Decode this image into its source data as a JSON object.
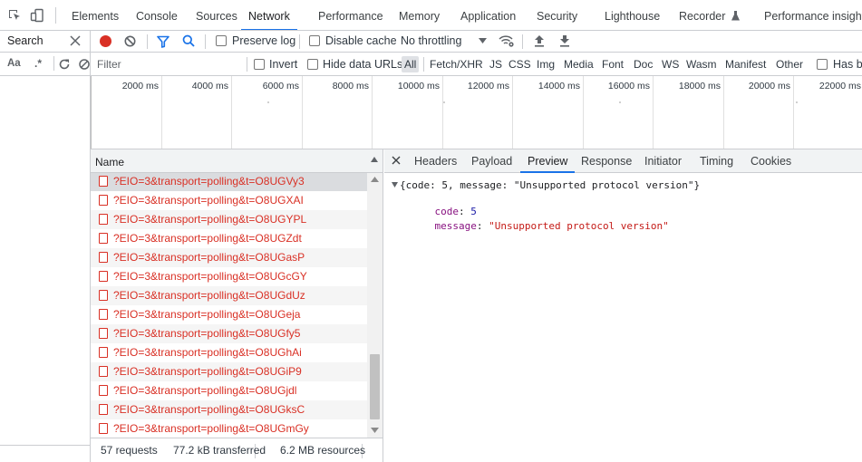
{
  "main_tabs": [
    "Elements",
    "Console",
    "Sources",
    "Network",
    "Performance",
    "Memory",
    "Application",
    "Security",
    "Lighthouse",
    "Recorder",
    "Performance insights"
  ],
  "active_tab": "Network",
  "sidebar": {
    "search_label": "Search",
    "match_case": "Aa",
    "regex": ".*"
  },
  "toolbar": {
    "preserve_log": "Preserve log",
    "disable_cache": "Disable cache",
    "throttling": "No throttling"
  },
  "filterbar": {
    "filter_placeholder": "Filter",
    "invert": "Invert",
    "hide_data_urls": "Hide data URLs",
    "types": [
      "All",
      "Fetch/XHR",
      "JS",
      "CSS",
      "Img",
      "Media",
      "Font",
      "Doc",
      "WS",
      "Wasm",
      "Manifest",
      "Other"
    ],
    "selected_type": "All",
    "has_blocked": "Has bl"
  },
  "overview": {
    "ticks": [
      "2000 ms",
      "4000 ms",
      "6000 ms",
      "8000 ms",
      "10000 ms",
      "12000 ms",
      "14000 ms",
      "16000 ms",
      "18000 ms",
      "20000 ms",
      "22000 ms"
    ]
  },
  "requests": {
    "column_name": "Name",
    "rows": [
      "?EIO=3&transport=polling&t=O8UGVy3",
      "?EIO=3&transport=polling&t=O8UGXAI",
      "?EIO=3&transport=polling&t=O8UGYPL",
      "?EIO=3&transport=polling&t=O8UGZdt",
      "?EIO=3&transport=polling&t=O8UGasP",
      "?EIO=3&transport=polling&t=O8UGcGY",
      "?EIO=3&transport=polling&t=O8UGdUz",
      "?EIO=3&transport=polling&t=O8UGeja",
      "?EIO=3&transport=polling&t=O8UGfy5",
      "?EIO=3&transport=polling&t=O8UGhAi",
      "?EIO=3&transport=polling&t=O8UGiP9",
      "?EIO=3&transport=polling&t=O8UGjdl",
      "?EIO=3&transport=polling&t=O8UGksC",
      "?EIO=3&transport=polling&t=O8UGmGy"
    ],
    "status_requests": "57 requests",
    "status_transferred": "77.2 kB transferred",
    "status_resources": "6.2 MB resources"
  },
  "details": {
    "tabs": [
      "Headers",
      "Payload",
      "Preview",
      "Response",
      "Initiator",
      "Timing",
      "Cookies"
    ],
    "active_tab": "Preview",
    "preview_summary": "{code: 5, message: \"Unsupported protocol version\"}",
    "code_key": "code",
    "code_value": "5",
    "message_key": "message",
    "message_value": "\"Unsupported protocol version\""
  },
  "colors": {
    "accent": "#1a73e8",
    "error_text": "#d93025",
    "record": "#d93025"
  }
}
